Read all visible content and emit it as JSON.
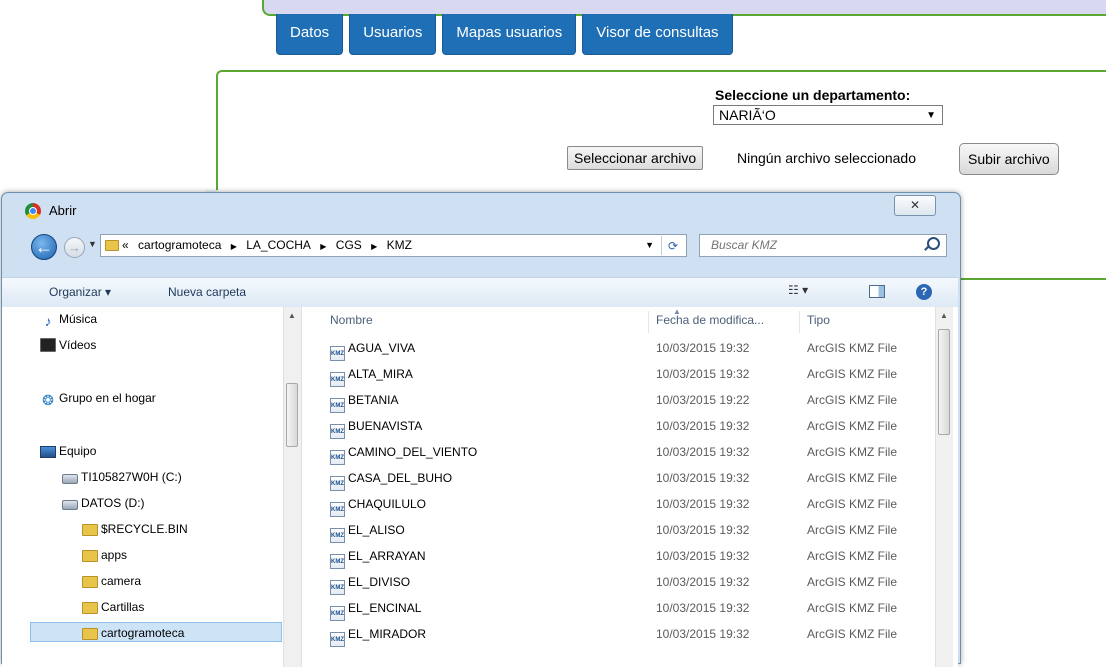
{
  "webpage": {
    "nav_tabs": [
      "Datos",
      "Usuarios",
      "Mapas usuarios",
      "Visor de consultas"
    ],
    "department_label": "Seleccione un departamento:",
    "department_value": "NARIÃ‘O",
    "file_button": "Seleccionar archivo",
    "file_status": "Ningún archivo seleccionado",
    "upload_button": "Subir archivo"
  },
  "dialog": {
    "title": "Abrir",
    "close_label": "✕",
    "breadcrumb": {
      "prefix": "«",
      "parts": [
        "cartogramoteca",
        "LA_COCHA",
        "CGS",
        "KMZ"
      ]
    },
    "search_placeholder": "Buscar KMZ",
    "toolbar": {
      "organize": "Organizar ▾",
      "new_folder": "Nueva carpeta"
    },
    "nav_items": [
      {
        "label": "Música",
        "icon": "music-icon"
      },
      {
        "label": "Vídeos",
        "icon": "video-icon"
      },
      {
        "label": "Grupo en el hogar",
        "icon": "homegroup-icon"
      },
      {
        "label": "Equipo",
        "icon": "computer-icon"
      },
      {
        "label": "TI105827W0H (C:)",
        "icon": "drive-icon"
      },
      {
        "label": "DATOS (D:)",
        "icon": "drive-icon"
      },
      {
        "label": "$RECYCLE.BIN",
        "icon": "folder-icon"
      },
      {
        "label": "apps",
        "icon": "folder-icon"
      },
      {
        "label": "camera",
        "icon": "folder-icon"
      },
      {
        "label": "Cartillas",
        "icon": "folder-icon"
      },
      {
        "label": "cartogramoteca",
        "icon": "folder-icon"
      }
    ],
    "columns": {
      "name": "Nombre",
      "date": "Fecha de modifica...",
      "type": "Tipo"
    },
    "files": [
      {
        "name": "AGUA_VIVA",
        "date": "10/03/2015 19:32",
        "type": "ArcGIS KMZ File"
      },
      {
        "name": "ALTA_MIRA",
        "date": "10/03/2015 19:32",
        "type": "ArcGIS KMZ File"
      },
      {
        "name": "BETANIA",
        "date": "10/03/2015 19:22",
        "type": "ArcGIS KMZ File"
      },
      {
        "name": "BUENAVISTA",
        "date": "10/03/2015 19:32",
        "type": "ArcGIS KMZ File"
      },
      {
        "name": "CAMINO_DEL_VIENTO",
        "date": "10/03/2015 19:32",
        "type": "ArcGIS KMZ File"
      },
      {
        "name": "CASA_DEL_BUHO",
        "date": "10/03/2015 19:32",
        "type": "ArcGIS KMZ File"
      },
      {
        "name": "CHAQUILULO",
        "date": "10/03/2015 19:32",
        "type": "ArcGIS KMZ File"
      },
      {
        "name": "EL_ALISO",
        "date": "10/03/2015 19:32",
        "type": "ArcGIS KMZ File"
      },
      {
        "name": "EL_ARRAYAN",
        "date": "10/03/2015 19:32",
        "type": "ArcGIS KMZ File"
      },
      {
        "name": "EL_DIVISO",
        "date": "10/03/2015 19:32",
        "type": "ArcGIS KMZ File"
      },
      {
        "name": "EL_ENCINAL",
        "date": "10/03/2015 19:32",
        "type": "ArcGIS KMZ File"
      },
      {
        "name": "EL_MIRADOR",
        "date": "10/03/2015 19:32",
        "type": "ArcGIS KMZ File"
      }
    ]
  }
}
